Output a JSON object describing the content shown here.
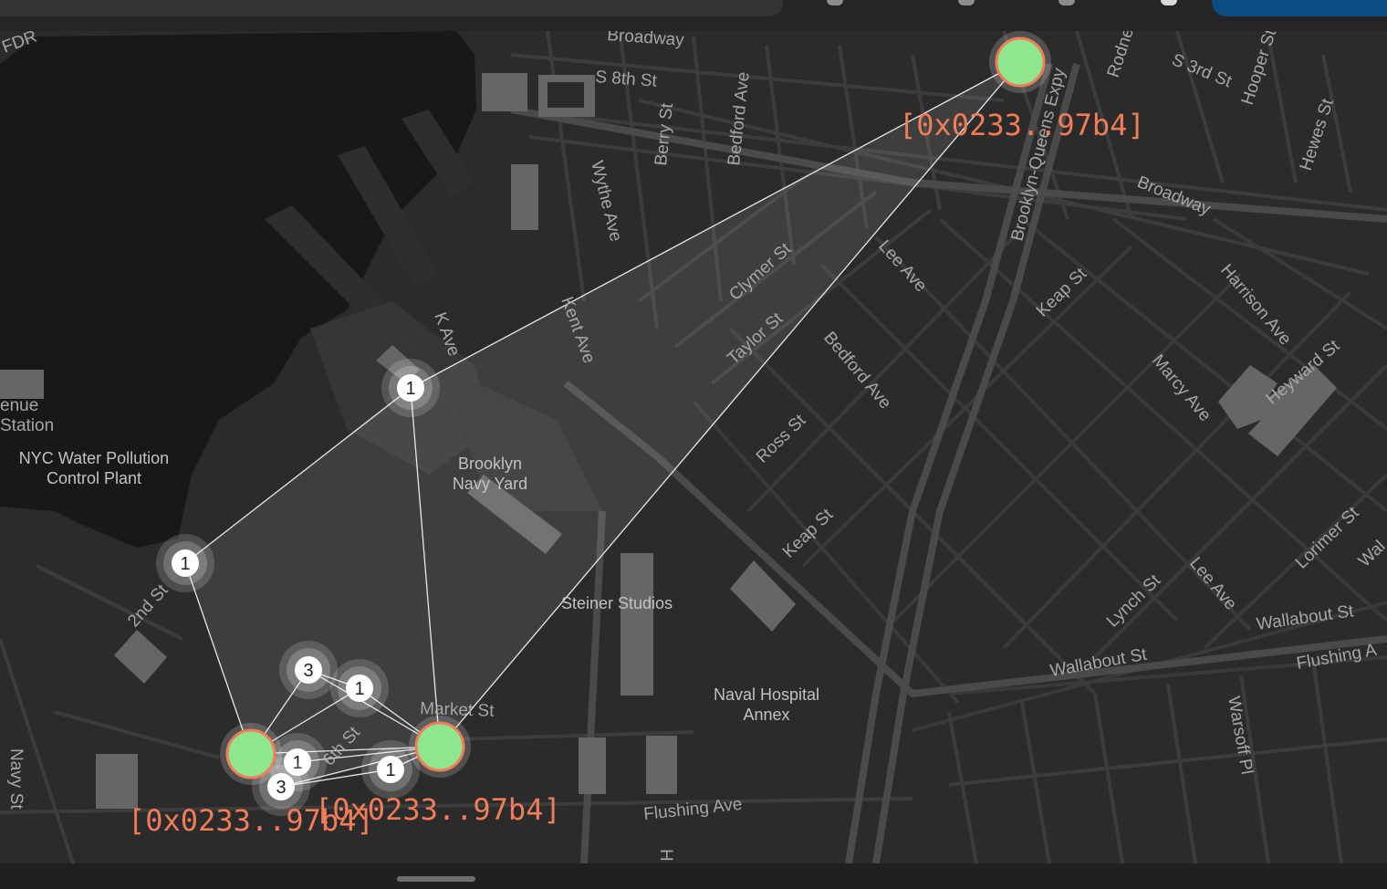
{
  "colors": {
    "land": "#2b2b2b",
    "water": "#181818",
    "road": "#3d3d3d",
    "building": "#666666",
    "node_fill": "#8ee78e",
    "node_stroke": "#f07c58",
    "label": "#f07c58",
    "cluster_fill": "#ffffff"
  },
  "streets": {
    "broadway_top": "Broadway",
    "fdr": "FDR",
    "s8th": "S 8th St",
    "berry": "Berry St",
    "bedford_top": "Bedford Ave",
    "bqe": "Brooklyn-Queens Expy",
    "rodney": "Rodne",
    "s3rd": "S 3rd St",
    "hooper": "Hooper St",
    "hewes": "Hewes St",
    "broadway": "Broadway",
    "wythe": "Wythe Ave",
    "kent": "Kent Ave",
    "kave": "K Ave",
    "clymer": "Clymer St",
    "taylor": "Taylor St",
    "lee_top": "Lee Ave",
    "bedford": "Bedford Ave",
    "keap_top": "Keap St",
    "harrison": "Harrison Ave",
    "marcy": "Marcy Ave",
    "heyward": "Heyward St",
    "ross": "Ross St",
    "keap": "Keap St",
    "lorimer": "Lorimer St",
    "wal": "Wal",
    "lynch": "Lynch St",
    "lee": "Lee Ave",
    "wallabout_right": "Wallabout St",
    "flushing_right": "Flushing A",
    "wallabout": "Wallabout St",
    "warsoff": "Warsoff Pl",
    "second": "2nd St",
    "sixth": "6th St",
    "market": "Market St",
    "flushing": "Flushing Ave",
    "navy_st": "Navy St",
    "h": "H",
    "enue": "enue",
    "station": "Station"
  },
  "pois": {
    "nyc_water_1": "NYC Water Pollution",
    "nyc_water_2": "Control Plant",
    "navy_yard_1": "Brooklyn",
    "navy_yard_2": "Navy Yard",
    "steiner": "Steiner Studios",
    "naval_1": "Naval Hospital",
    "naval_2": "Annex"
  },
  "nodes": [
    {
      "id": "node-top",
      "label": "[0x0233..97b4]"
    },
    {
      "id": "node-left",
      "label": "[0x0233..97b4]"
    },
    {
      "id": "node-right",
      "label": "[0x0233..97b4]"
    }
  ],
  "clusters": [
    "1",
    "1",
    "3",
    "1",
    "1",
    "3",
    "1"
  ]
}
